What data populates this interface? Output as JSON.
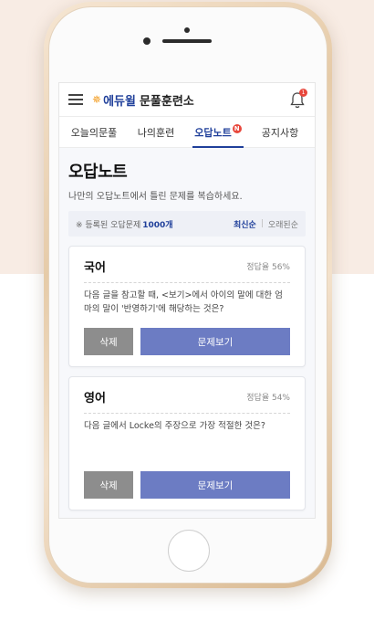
{
  "app": {
    "logo_star": "✵",
    "logo_brand": "에듀윌",
    "logo_name": "문풀훈련소",
    "notification_count": "1"
  },
  "tabs": [
    {
      "label": "오늘의문풀"
    },
    {
      "label": "나의훈련"
    },
    {
      "label": "오답노트",
      "badge": "N"
    },
    {
      "label": "공지사항"
    }
  ],
  "page": {
    "title": "오답노트",
    "subtitle": "나만의 오답노트에서 틀린 문제를 복습하세요."
  },
  "info": {
    "prefix": "※ 등록된 오답문제 ",
    "count": "1000개",
    "sort_new": "최신순",
    "sort_old": "오래된순"
  },
  "cards": [
    {
      "subject": "국어",
      "rate": "정답율 56%",
      "question": "다음 글을 참고할 때, <보기>에서 아이의 말에 대한 엄마의 말이 '반영하기'에 해당하는 것은?",
      "delete_label": "삭제",
      "view_label": "문제보기"
    },
    {
      "subject": "영어",
      "rate": "정답율 54%",
      "question": "다음 글에서 Locke의 주장으로 가장 적절한 것은?",
      "delete_label": "삭제",
      "view_label": "문제보기"
    }
  ],
  "colors": {
    "brand": "#1f3f9a",
    "accent_orange": "#f29a1b",
    "badge_red": "#e8473c",
    "view_button": "#6c7cc3",
    "delete_button": "#8d8d8d"
  }
}
